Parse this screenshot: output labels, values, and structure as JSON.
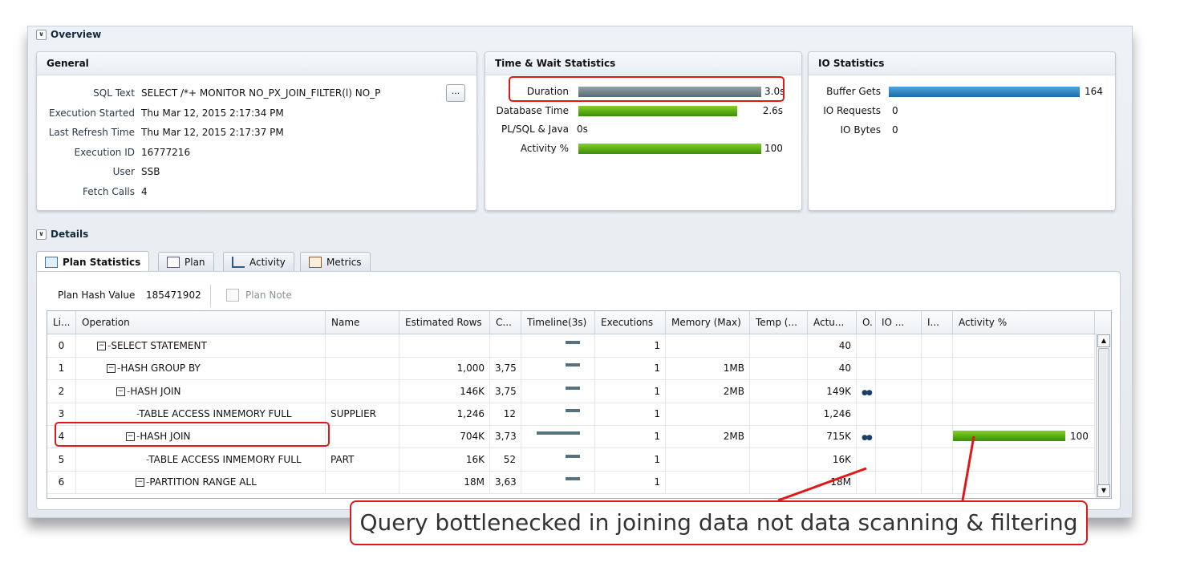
{
  "overview": {
    "title": "Overview"
  },
  "general": {
    "title": "General",
    "rows": [
      {
        "label": "SQL Text",
        "value": "SELECT /*+ MONITOR NO_PX_JOIN_FILTER(l) NO_P"
      },
      {
        "label": "Execution Started",
        "value": "Thu Mar 12, 2015 2:17:34 PM"
      },
      {
        "label": "Last Refresh Time",
        "value": "Thu Mar 12, 2015 2:17:37 PM"
      },
      {
        "label": "Execution ID",
        "value": "16777216"
      },
      {
        "label": "User",
        "value": "SSB"
      },
      {
        "label": "Fetch Calls",
        "value": "4"
      }
    ],
    "more_button": "..."
  },
  "time_wait": {
    "title": "Time & Wait Statistics",
    "rows": [
      {
        "label": "Duration",
        "value": "3.0s",
        "fraction": 1.0,
        "color": "#6b7b85"
      },
      {
        "label": "Database Time",
        "value": "2.6s",
        "fraction": 0.87,
        "color": "#4caf1a"
      },
      {
        "label": "PL/SQL & Java",
        "value": "0s",
        "fraction": 0,
        "color": "#4caf1a"
      },
      {
        "label": "Activity %",
        "value": "100",
        "fraction": 1.0,
        "color": "#4caf1a"
      }
    ]
  },
  "io_stats": {
    "title": "IO Statistics",
    "rows": [
      {
        "label": "Buffer Gets",
        "value": "164",
        "fraction": 1.0,
        "color": "#2a7fc0"
      },
      {
        "label": "IO Requests",
        "value": "0",
        "fraction": 0
      },
      {
        "label": "IO Bytes",
        "value": "0",
        "fraction": 0
      }
    ]
  },
  "details": {
    "title": "Details",
    "tabs": [
      {
        "label": "Plan Statistics",
        "icon": "plan-statistics-icon",
        "active": true
      },
      {
        "label": "Plan",
        "icon": "plan-tree-icon"
      },
      {
        "label": "Activity",
        "icon": "activity-chart-icon"
      },
      {
        "label": "Metrics",
        "icon": "metrics-icon"
      }
    ],
    "plan_hash_label": "Plan Hash Value",
    "plan_hash_value": "185471902",
    "plan_note_label": "Plan Note"
  },
  "grid": {
    "headers": [
      "Li...",
      "Operation",
      "Name",
      "Estimated Rows",
      "C...",
      "Timeline(3s)",
      "Executions",
      "Memory (Max)",
      "Temp (...",
      "Actu...",
      "O.",
      "IO ...",
      "I...",
      "Activity %"
    ],
    "rows": [
      {
        "line": "0",
        "op": "SELECT STATEMENT",
        "depth": 0,
        "name": "",
        "est": "",
        "cost": "",
        "timeline_fraction": 0.33,
        "exec": "1",
        "mem": "",
        "actual": "40",
        "icon": false,
        "activity": "",
        "activity_fraction": 0
      },
      {
        "line": "1",
        "op": "HASH GROUP BY",
        "depth": 1,
        "name": "",
        "est": "1,000",
        "cost": "3,75",
        "timeline_fraction": 0.33,
        "exec": "1",
        "mem": "1MB",
        "actual": "40",
        "icon": false,
        "activity": "",
        "activity_fraction": 0
      },
      {
        "line": "2",
        "op": "HASH JOIN",
        "depth": 2,
        "name": "",
        "est": "146K",
        "cost": "3,75",
        "timeline_fraction": 0.33,
        "exec": "1",
        "mem": "2MB",
        "actual": "149K",
        "icon": true,
        "activity": "",
        "activity_fraction": 0
      },
      {
        "line": "3",
        "op": "TABLE ACCESS INMEMORY FULL",
        "depth": 3,
        "name": "SUPPLIER",
        "est": "1,246",
        "cost": "12",
        "timeline_fraction": 0.33,
        "exec": "1",
        "mem": "",
        "actual": "1,246",
        "icon": false,
        "activity": "",
        "activity_fraction": 0
      },
      {
        "line": "4",
        "op": "HASH JOIN",
        "depth": 3,
        "name": "",
        "est": "704K",
        "cost": "3,73",
        "timeline_fraction": 1.0,
        "exec": "1",
        "mem": "2MB",
        "actual": "715K",
        "icon": true,
        "activity": "100",
        "activity_fraction": 1.0
      },
      {
        "line": "5",
        "op": "TABLE ACCESS INMEMORY FULL",
        "depth": 4,
        "name": "PART",
        "est": "16K",
        "cost": "52",
        "timeline_fraction": 0.33,
        "exec": "1",
        "mem": "",
        "actual": "16K",
        "icon": false,
        "activity": "",
        "activity_fraction": 0
      },
      {
        "line": "6",
        "op": "PARTITION RANGE ALL",
        "depth": 4,
        "name": "",
        "est": "18M",
        "cost": "3,63",
        "timeline_fraction": 0.33,
        "exec": "1",
        "mem": "",
        "actual": "18M",
        "icon": false,
        "activity": "",
        "activity_fraction": 0
      }
    ]
  },
  "callout": "Query bottlenecked in joining data not data scanning & filtering",
  "colors": {
    "highlight": "#e01818",
    "accent_green": "#4caf1a",
    "accent_blue": "#2a7fc0"
  }
}
